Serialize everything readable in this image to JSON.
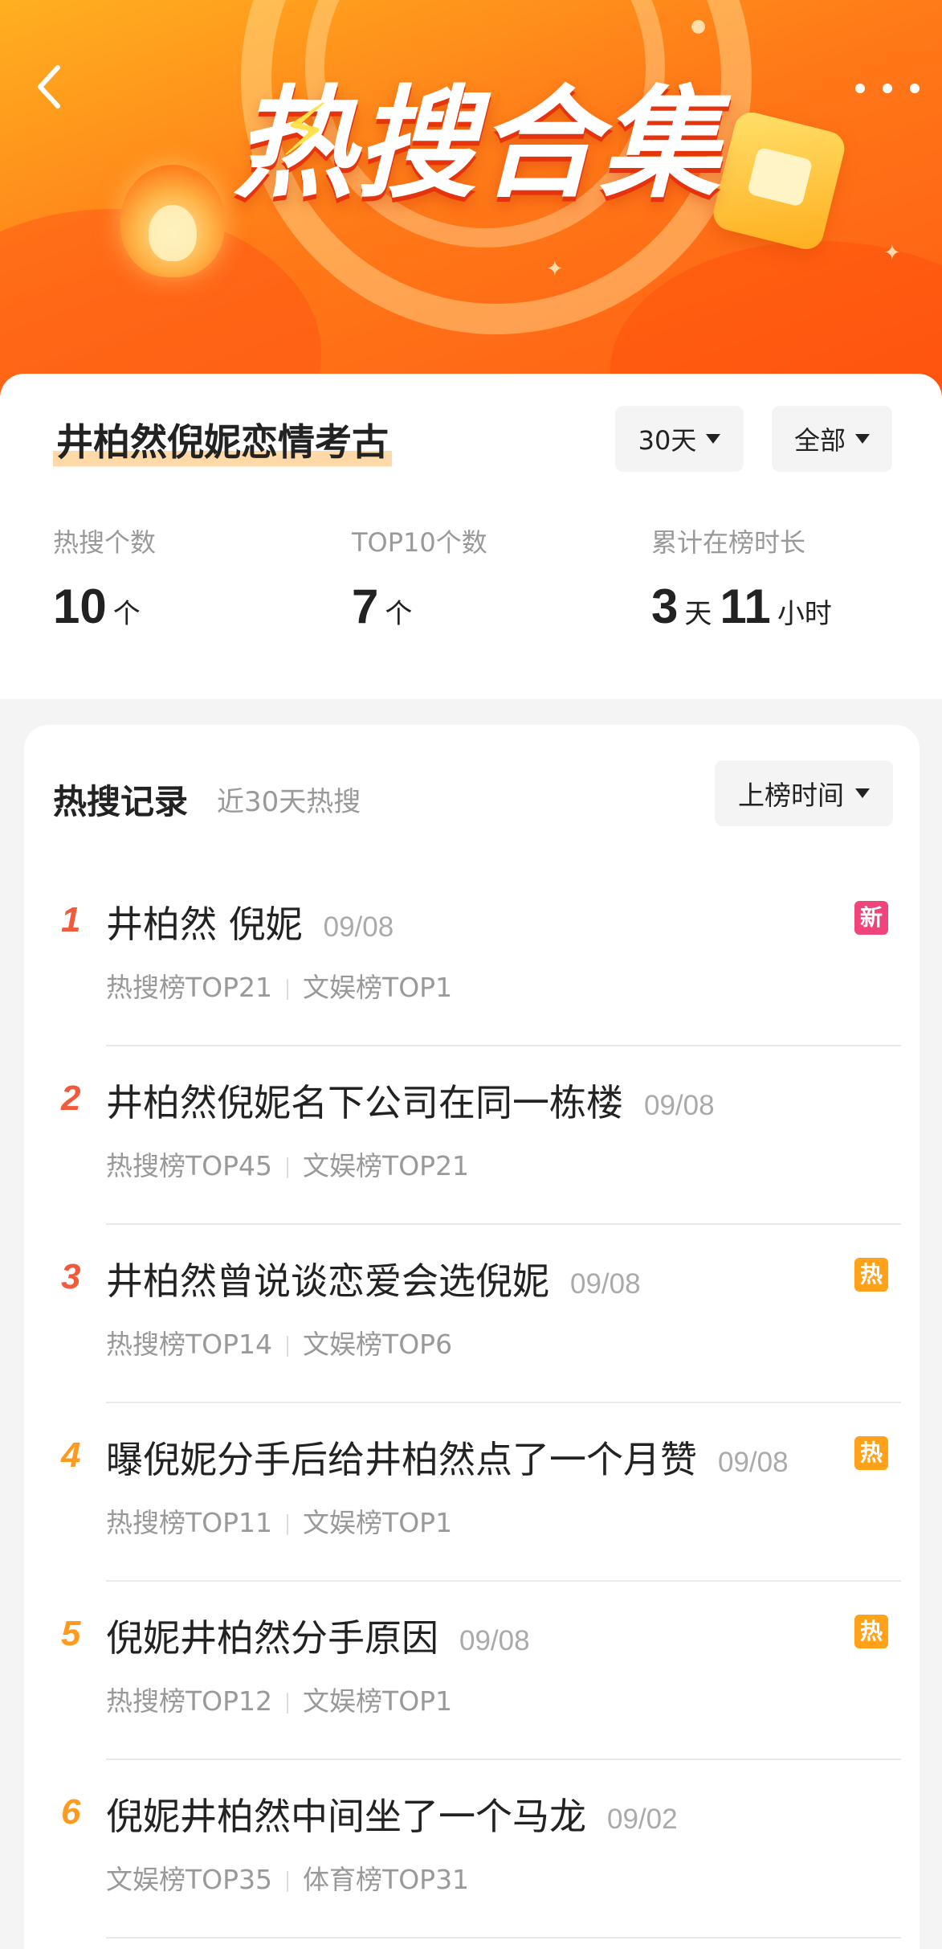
{
  "banner": {
    "title": "热搜合集",
    "back_icon": "chevron-left-icon",
    "more_icon": "more-dots-icon"
  },
  "topic": {
    "title": "井柏然倪妮恋情考古",
    "filter_days": "30天",
    "filter_type": "全部"
  },
  "stats": {
    "hot_count_label": "热搜个数",
    "hot_count_value": "10",
    "hot_count_unit": "个",
    "top10_label": "TOP10个数",
    "top10_value": "7",
    "top10_unit": "个",
    "duration_label": "累计在榜时长",
    "duration_days": "3",
    "duration_days_unit": "天",
    "duration_hours": "11",
    "duration_hours_unit": "小时"
  },
  "records": {
    "title": "热搜记录",
    "subtitle": "近30天热搜",
    "sort_label": "上榜时间",
    "items": [
      {
        "rank": "1",
        "title": "井柏然 倪妮",
        "date": "09/08",
        "tag1": "热搜榜TOP21",
        "tag2": "文娱榜TOP1",
        "badge": "新",
        "badge_color": "#f0457a",
        "rank_color": "#f25a3c"
      },
      {
        "rank": "2",
        "title": "井柏然倪妮名下公司在同一栋楼",
        "date": "09/08",
        "tag1": "热搜榜TOP45",
        "tag2": "文娱榜TOP21",
        "badge": "",
        "badge_color": "",
        "rank_color": "#f25a3c"
      },
      {
        "rank": "3",
        "title": "井柏然曾说谈恋爱会选倪妮",
        "date": "09/08",
        "tag1": "热搜榜TOP14",
        "tag2": "文娱榜TOP6",
        "badge": "热",
        "badge_color": "#ffa21a",
        "rank_color": "#f25a3c"
      },
      {
        "rank": "4",
        "title": "曝倪妮分手后给井柏然点了一个月赞",
        "date": "09/08",
        "tag1": "热搜榜TOP11",
        "tag2": "文娱榜TOP1",
        "badge": "热",
        "badge_color": "#ffa21a",
        "rank_color": "#ff9a1e"
      },
      {
        "rank": "5",
        "title": "倪妮井柏然分手原因",
        "date": "09/08",
        "tag1": "热搜榜TOP12",
        "tag2": "文娱榜TOP1",
        "badge": "热",
        "badge_color": "#ffa21a",
        "rank_color": "#ff9a1e"
      },
      {
        "rank": "6",
        "title": "倪妮井柏然中间坐了一个马龙",
        "date": "09/02",
        "tag1": "文娱榜TOP35",
        "tag2": "体育榜TOP31",
        "badge": "",
        "badge_color": "",
        "rank_color": "#ff9a1e"
      }
    ]
  }
}
